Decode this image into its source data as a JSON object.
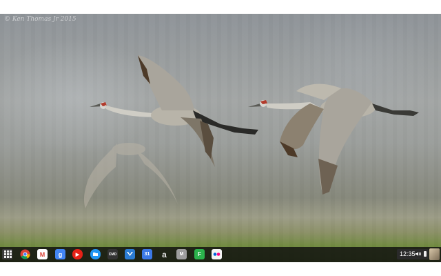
{
  "wallpaper": {
    "watermark": "© Ken Thomas Jr 2015"
  },
  "shelf": {
    "launcher_icon": "app-launcher-icon",
    "apps": [
      {
        "name": "chrome",
        "icon": "chrome-icon",
        "label": "",
        "color": "#db4437"
      },
      {
        "name": "gmail",
        "icon": "gmail-icon",
        "label": "M",
        "color": "#ffffff"
      },
      {
        "name": "google-search",
        "icon": "google-search-icon",
        "label": "g",
        "color": "#4285f4"
      },
      {
        "name": "youtube",
        "icon": "youtube-icon",
        "label": "▶",
        "color": "#e62117"
      },
      {
        "name": "files",
        "icon": "files-icon",
        "label": "",
        "color": "#2196f3"
      },
      {
        "name": "crosh",
        "icon": "terminal-icon",
        "label": "CMD",
        "color": "#333333"
      },
      {
        "name": "twitter-client",
        "icon": "bird-icon",
        "label": "",
        "color": "#2b7cd3"
      },
      {
        "name": "calendar",
        "icon": "calendar-icon",
        "label": "31",
        "color": "#3b78e7"
      },
      {
        "name": "amazon",
        "icon": "amazon-icon",
        "label": "a",
        "color": "#232f3e"
      },
      {
        "name": "mail",
        "icon": "mail-icon",
        "label": "M",
        "color": "#9e9e9e"
      },
      {
        "name": "feedly",
        "icon": "feedly-icon",
        "label": "F",
        "color": "#2bb24c"
      },
      {
        "name": "flickr",
        "icon": "flickr-icon",
        "label": "",
        "color": "#f5f5f5"
      }
    ],
    "tray": {
      "time": "12:35",
      "volume_icon": "mute-icon",
      "battery_icon": "battery-icon"
    },
    "avatar_icon": "avatar-icon"
  }
}
